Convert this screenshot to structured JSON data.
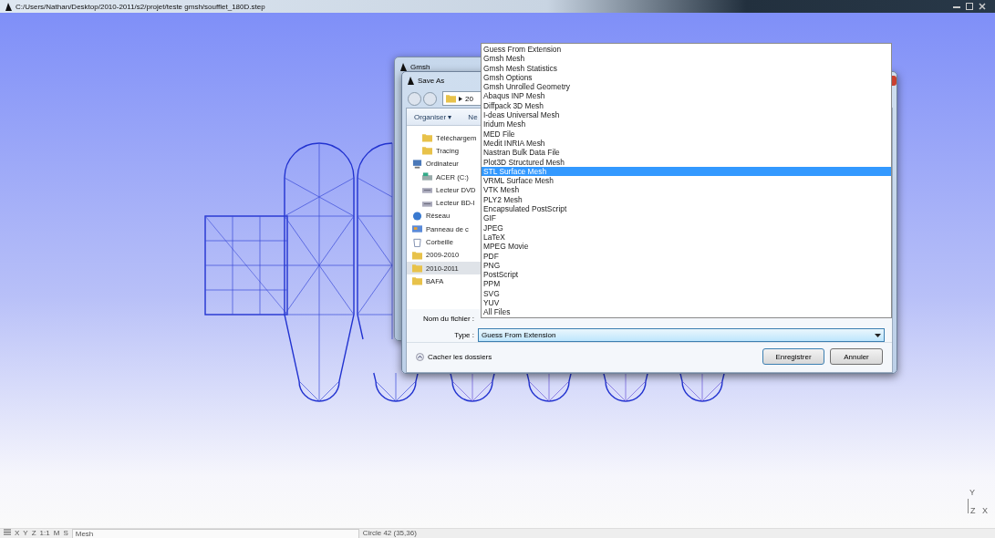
{
  "window": {
    "title": "C:/Users/Nathan/Desktop/2010-2011/s2/projet/teste gmsh/soufflet_180D.step"
  },
  "gmsh_window": {
    "title": "Gmsh"
  },
  "save_dialog": {
    "title": "Save As",
    "breadcrumb": "20",
    "toolbar": [
      "Organiser ▾",
      "Ne"
    ],
    "sidebar": {
      "group_items": [
        {
          "label": "Téléchargem",
          "kind": "folder",
          "selected": false
        },
        {
          "label": "Tracing",
          "kind": "folder",
          "selected": false
        }
      ],
      "items": [
        {
          "label": "Ordinateur",
          "kind": "computer",
          "selected": false,
          "children": [
            {
              "label": "ACER (C:)",
              "kind": "disk",
              "selected": false
            },
            {
              "label": "Lecteur DVD",
              "kind": "drive",
              "selected": false
            },
            {
              "label": "Lecteur BD-I",
              "kind": "drive",
              "selected": false
            }
          ]
        },
        {
          "label": "Réseau",
          "kind": "network",
          "selected": false
        },
        {
          "label": "Panneau de c",
          "kind": "panel",
          "selected": false
        },
        {
          "label": "Corbeille",
          "kind": "trash",
          "selected": false
        },
        {
          "label": "2009-2010",
          "kind": "folder",
          "selected": false
        },
        {
          "label": "2010-2011",
          "kind": "folder",
          "selected": true
        },
        {
          "label": "BAFA",
          "kind": "folder",
          "selected": false
        }
      ]
    },
    "filename_label": "Nom du fichier :",
    "type_label": "Type :",
    "type_value": "Guess From Extension",
    "hide_folders": "Cacher les dossiers",
    "buttons": [
      "Enregistrer",
      "Annuler"
    ]
  },
  "type_list": [
    {
      "label": "Guess From Extension",
      "selected": false
    },
    {
      "label": "Gmsh Mesh",
      "selected": false
    },
    {
      "label": "Gmsh Mesh Statistics",
      "selected": false
    },
    {
      "label": "Gmsh Options",
      "selected": false
    },
    {
      "label": "Gmsh Unrolled Geometry",
      "selected": false
    },
    {
      "label": "Abaqus INP Mesh",
      "selected": false
    },
    {
      "label": "Diffpack 3D Mesh",
      "selected": false
    },
    {
      "label": "I-deas Universal Mesh",
      "selected": false
    },
    {
      "label": "Iridum Mesh",
      "selected": false
    },
    {
      "label": "MED File",
      "selected": false
    },
    {
      "label": "Medit INRIA Mesh",
      "selected": false
    },
    {
      "label": "Nastran Bulk Data File",
      "selected": false
    },
    {
      "label": "Plot3D Structured Mesh",
      "selected": false
    },
    {
      "label": "STL Surface Mesh",
      "selected": true
    },
    {
      "label": "VRML Surface Mesh",
      "selected": false
    },
    {
      "label": "VTK Mesh",
      "selected": false
    },
    {
      "label": "PLY2 Mesh",
      "selected": false
    },
    {
      "label": "Encapsulated PostScript",
      "selected": false
    },
    {
      "label": "GIF",
      "selected": false
    },
    {
      "label": "JPEG",
      "selected": false
    },
    {
      "label": "LaTeX",
      "selected": false
    },
    {
      "label": "MPEG Movie",
      "selected": false
    },
    {
      "label": "PDF",
      "selected": false
    },
    {
      "label": "PNG",
      "selected": false
    },
    {
      "label": "PostScript",
      "selected": false
    },
    {
      "label": "PPM",
      "selected": false
    },
    {
      "label": "SVG",
      "selected": false
    },
    {
      "label": "YUV",
      "selected": false
    },
    {
      "label": "All Files",
      "selected": false
    }
  ],
  "axes": {
    "y": "Y",
    "z": "Z",
    "x": "X"
  },
  "status_bar": {
    "tools": [
      "X",
      "Y",
      "Z",
      "1:1",
      "M",
      "S"
    ],
    "mode": "Mesh",
    "info": "Circle 42 (35,36)"
  }
}
